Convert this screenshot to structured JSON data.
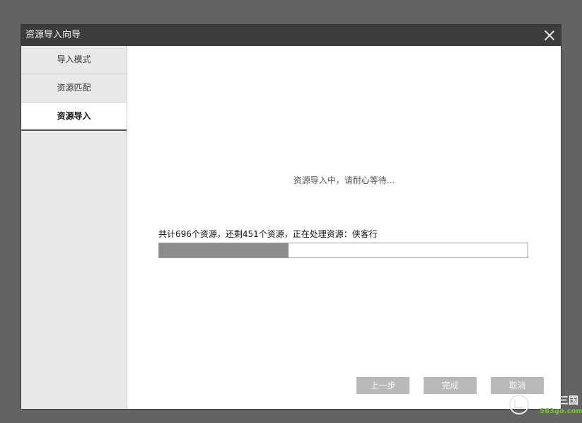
{
  "window": {
    "title": "资源导入向导",
    "close_icon": "close-icon"
  },
  "sidebar": {
    "steps": [
      {
        "label": "导入模式",
        "active": false
      },
      {
        "label": "资源匹配",
        "active": false
      },
      {
        "label": "资源导入",
        "active": true
      }
    ]
  },
  "main": {
    "waiting_text": "资源导入中，请耐心等待...",
    "progress_text": "共计696个资源，还剩451个资源，正在处理资源：侠客行",
    "total": 696,
    "remaining": 451,
    "current_item": "侠客行",
    "progress_fraction": 0.352
  },
  "buttons": {
    "prev": "上一步",
    "finish": "完成",
    "cancel": "取消"
  },
  "watermark": {
    "text1": "三国",
    "text2": "583go.com"
  },
  "colors": {
    "titlebar": "#3c3c3c",
    "sidebar": "#e9e9e9",
    "progress_fill": "#8c8c8c",
    "button_disabled": "#b9b9b9",
    "watermark_green": "#7dc242"
  }
}
